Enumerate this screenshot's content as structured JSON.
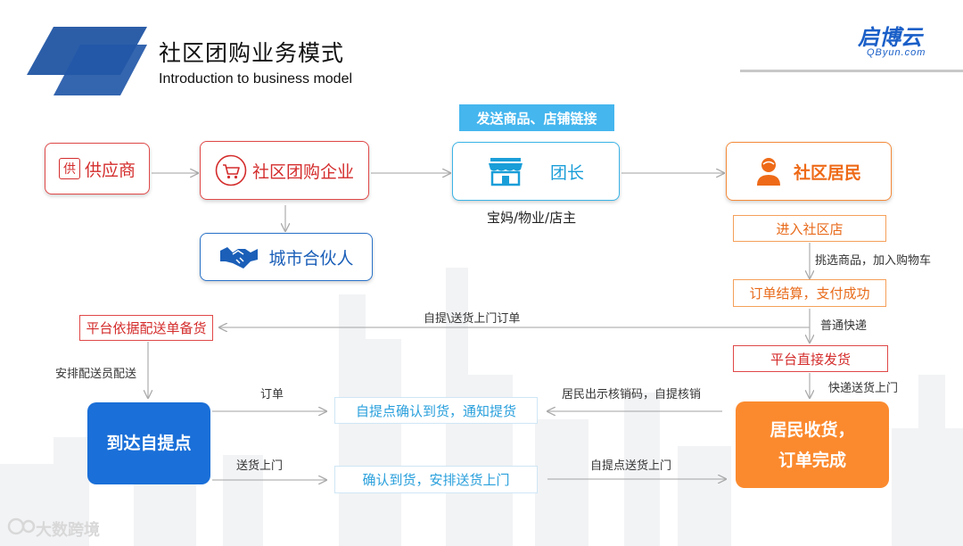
{
  "header": {
    "title": "社区团购业务模式",
    "subtitle": "Introduction to business model",
    "brand": "启博云",
    "brand_sub": "QByun.com"
  },
  "nodes": {
    "supplier": {
      "label": "供应商",
      "icon_char": "供"
    },
    "enterprise": {
      "label": "社区团购企业"
    },
    "city_partner": {
      "label": "城市合伙人"
    },
    "leader": {
      "label": "团长"
    },
    "leader_note": "宝妈/物业/店主",
    "resident": {
      "label": "社区居民"
    },
    "send_banner": "发送商品、店铺链接"
  },
  "flow": {
    "enter_store": "进入社区店",
    "select_goods": "挑选商品，加入购物车",
    "checkout": "订单结算，支付成功",
    "normal_express": "普通快递",
    "direct_ship": "平台直接发货",
    "express_delivery": "快递送货上门",
    "self_pickup_order": "自提\\送货上门订单",
    "platform_stock": "平台依据配送单备货",
    "arrange_delivery": "安排配送员配送",
    "pickup_point": "到达自提点",
    "order_label": "订单",
    "delivery_label": "送货上门",
    "confirm_notify": "自提点确认到货，通知提货",
    "confirm_deliver": "确认到货，安排送货上门",
    "resident_code": "居民出示核销码，自提核销",
    "pickup_deliver": "自提点送货上门",
    "received_line1": "居民收货，",
    "received_line2": "订单完成"
  },
  "watermark": "大数跨境",
  "colors": {
    "red": "#e04848",
    "cyan": "#3ab4e6",
    "orange": "#f58a3a",
    "blue_dark": "#1b5fb8",
    "pickup_fill": "#1a6fd8",
    "done_fill": "#fb8a2e"
  },
  "icons": [
    "logo-parallelogram-icon",
    "supplier-icon",
    "cart-icon",
    "handshake-icon",
    "shop-icon",
    "person-icon",
    "watermark-logo-icon"
  ]
}
